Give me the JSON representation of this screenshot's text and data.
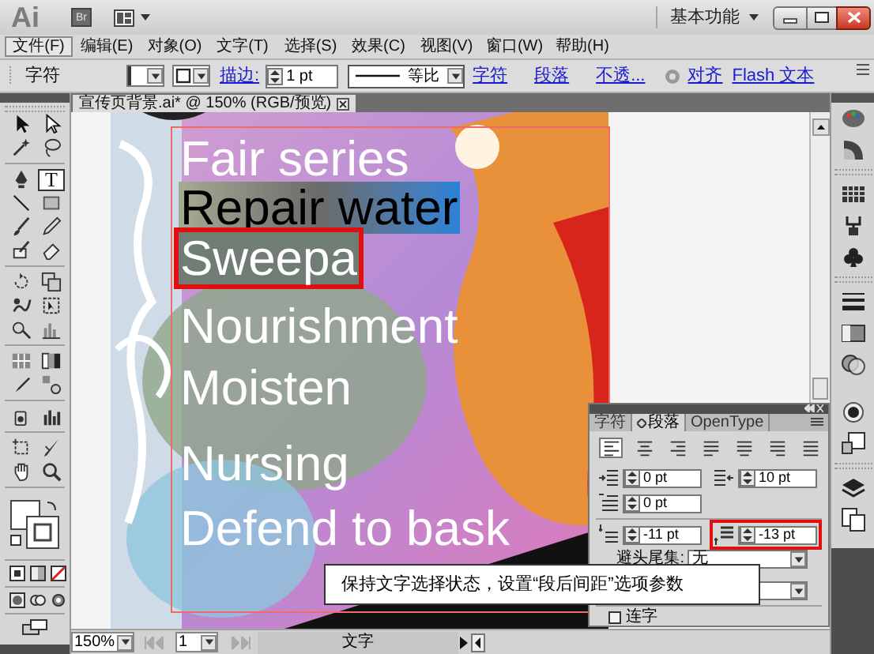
{
  "app_bar": {
    "logo": "Ai",
    "bridge": "Br",
    "workspace": "基本功能"
  },
  "menu": [
    {
      "label": "文件(F)",
      "selected": true
    },
    {
      "label": "编辑(E)",
      "selected": false
    },
    {
      "label": "对象(O)",
      "selected": false
    },
    {
      "label": "文字(T)",
      "selected": false
    },
    {
      "label": "选择(S)",
      "selected": false
    },
    {
      "label": "效果(C)",
      "selected": false
    },
    {
      "label": "视图(V)",
      "selected": false
    },
    {
      "label": "窗口(W)",
      "selected": false
    },
    {
      "label": "帮助(H)",
      "selected": false
    }
  ],
  "control_bar": {
    "mode": "字符",
    "stroke_label": "描边:",
    "stroke_weight": "1 pt",
    "profile": "等比",
    "links": [
      "字符",
      "段落",
      "不透...",
      "对齐",
      "Flash 文本"
    ]
  },
  "document_tab": {
    "title": "宣传页背景.ai* @ 150% (RGB/预览)"
  },
  "tools": [
    {
      "kind": "select",
      "selected": false
    },
    {
      "kind": "direct-select",
      "selected": false
    },
    {
      "kind": "magic-wand",
      "selected": false
    },
    {
      "kind": "lasso",
      "selected": false
    },
    {
      "kind": "pen",
      "selected": false
    },
    {
      "kind": "type",
      "glyph": "T",
      "selected": true
    },
    {
      "kind": "line",
      "selected": false
    },
    {
      "kind": "rectangle",
      "selected": false
    },
    {
      "kind": "paintbrush",
      "selected": false
    },
    {
      "kind": "pencil",
      "selected": false
    },
    {
      "kind": "blob-brush",
      "selected": false
    },
    {
      "kind": "eraser",
      "selected": false
    },
    {
      "kind": "rotate",
      "selected": false
    },
    {
      "kind": "scale",
      "selected": false
    },
    {
      "kind": "warp",
      "selected": false
    },
    {
      "kind": "free-transform",
      "selected": false
    },
    {
      "kind": "shape-builder",
      "selected": false
    },
    {
      "kind": "graph",
      "selected": false
    },
    {
      "kind": "mesh",
      "selected": false
    },
    {
      "kind": "gradient",
      "selected": false
    },
    {
      "kind": "eyedropper",
      "selected": false
    },
    {
      "kind": "blend",
      "selected": false
    },
    {
      "kind": "symbol-sprayer",
      "selected": false
    },
    {
      "kind": "column-graph",
      "selected": false
    },
    {
      "kind": "artboard",
      "selected": false
    },
    {
      "kind": "slice",
      "selected": false
    },
    {
      "kind": "hand",
      "selected": false
    },
    {
      "kind": "zoom",
      "selected": false
    }
  ],
  "canvas_text": [
    {
      "text": "Fair series",
      "kind": "plain"
    },
    {
      "text": "Repair water",
      "kind": "inverse"
    },
    {
      "text": "Sweepa",
      "kind": "highlight",
      "marked": true
    },
    {
      "text": "Nourishment",
      "kind": "plain"
    },
    {
      "text": "Moisten",
      "kind": "plain"
    },
    {
      "text": "Nursing",
      "kind": "plain"
    },
    {
      "text": "Defend to bask",
      "kind": "plain"
    }
  ],
  "paragraph_panel": {
    "tabs": [
      {
        "label": "字符",
        "selected": false
      },
      {
        "label": "段落",
        "selected": true
      },
      {
        "label": "OpenType",
        "selected": false
      }
    ],
    "alignment": [
      {
        "selected": true
      },
      {
        "selected": false
      },
      {
        "selected": false
      },
      {
        "selected": false
      },
      {
        "selected": false
      },
      {
        "selected": false
      },
      {
        "selected": false
      }
    ],
    "fields": [
      {
        "kind": "left-indent",
        "value": "0 pt"
      },
      {
        "kind": "right-indent",
        "value": "10 pt"
      },
      {
        "kind": "first-line-indent",
        "value": "0 pt"
      },
      {
        "kind": "space-before",
        "value": "-11 pt"
      },
      {
        "kind": "space-after",
        "value": "-13 pt",
        "marked": true
      }
    ],
    "kinsoku_label": "避头尾集:",
    "kinsoku_value": "无",
    "hyphenate": {
      "label": "连字",
      "checked": false
    }
  },
  "callout": "保持文字选择状态，设置“段后间距”选项参数",
  "status_bar": {
    "zoom": "150%",
    "page": "1",
    "status": "文字"
  }
}
